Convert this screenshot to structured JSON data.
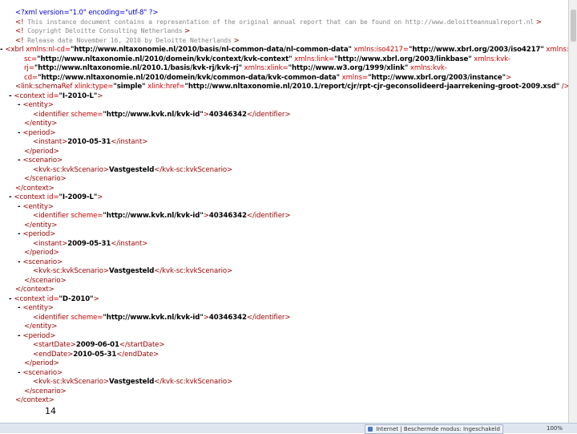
{
  "xml_lines": [
    {
      "indent": 1,
      "toggle": "",
      "parts": [
        [
          "pi",
          "<?xml version=\"1.0\" encoding=\"utf-8\" ?>"
        ]
      ]
    },
    {
      "indent": 1,
      "toggle": "",
      "parts": [
        [
          "tag",
          "<!"
        ],
        [
          "cm",
          "   This instance document contains a representation of the original annual report that can be found on http://www.deloitteannualreport.nl"
        ],
        [
          "tag",
          "          >"
        ]
      ]
    },
    {
      "indent": 1,
      "toggle": "",
      "parts": [
        [
          "tag",
          "<!"
        ],
        [
          "cm",
          "   Copyright Deloitte Consulting Netherlands"
        ],
        [
          "tag",
          "       >"
        ]
      ]
    },
    {
      "indent": 1,
      "toggle": "",
      "parts": [
        [
          "tag",
          "<!"
        ],
        [
          "cm",
          "   Release date November 16, 2010 by Deloitte Netherlands"
        ],
        [
          "tag",
          "       >"
        ]
      ]
    },
    {
      "indent": 0,
      "toggle": "-",
      "parts": [
        [
          "tag",
          "<xbrl "
        ],
        [
          "attr",
          "xmlns:nl-cd="
        ],
        [
          "val",
          "\"http://www.nltaxonomie.nl/2010/basis/nl-common-data/nl-common-data\""
        ],
        [
          "attr",
          " xmlns:iso4217="
        ],
        [
          "val",
          "\"http://www.xbrl.org/2003/iso4217\""
        ],
        [
          "attr",
          " xmlns:kvk-"
        ]
      ]
    },
    {
      "indent": 2,
      "toggle": "",
      "parts": [
        [
          "attr",
          "sc="
        ],
        [
          "val",
          "\"http://www.nltaxonomie.nl/2010/domein/kvk/context/kvk-context\""
        ],
        [
          "attr",
          " xmlns:link="
        ],
        [
          "val",
          "\"http://www.xbrl.org/2003/linkbase\""
        ],
        [
          "attr",
          " xmlns:kvk-"
        ]
      ]
    },
    {
      "indent": 2,
      "toggle": "",
      "parts": [
        [
          "attr",
          "rj="
        ],
        [
          "val",
          "\"http://www.nltaxonomie.nl/2010.1/basis/kvk-rj/kvk-rj\""
        ],
        [
          "attr",
          " xmlns:xlink="
        ],
        [
          "val",
          "\"http://www.w3.org/1999/xlink\""
        ],
        [
          "attr",
          " xmlns:kvk-"
        ]
      ]
    },
    {
      "indent": 2,
      "toggle": "",
      "parts": [
        [
          "attr",
          "cd="
        ],
        [
          "val",
          "\"http://www.nltaxonomie.nl/2010/domein/kvk/common-data/kvk-common-data\""
        ],
        [
          "attr",
          " xmlns="
        ],
        [
          "val",
          "\"http://www.xbrl.org/2003/instance\""
        ],
        [
          "tag",
          ">"
        ]
      ]
    },
    {
      "indent": 1,
      "toggle": "",
      "parts": [
        [
          "tag",
          "<link:schemaRef "
        ],
        [
          "attr",
          "xlink:type="
        ],
        [
          "val",
          "\"simple\""
        ],
        [
          "attr",
          " xlink:href="
        ],
        [
          "val",
          "\"http://www.nltaxonomie.nl/2010.1/report/cjr/rpt-cjr-geconsolideerd-jaarrekening-groot-2009.xsd\""
        ],
        [
          "tag",
          " />"
        ]
      ]
    },
    {
      "indent": 1,
      "toggle": "-",
      "parts": [
        [
          "tag",
          "<context "
        ],
        [
          "attr",
          "id="
        ],
        [
          "val",
          "\"I-2010-L\""
        ],
        [
          "tag",
          ">"
        ]
      ]
    },
    {
      "indent": 2,
      "toggle": "-",
      "parts": [
        [
          "tag",
          "<entity>"
        ]
      ]
    },
    {
      "indent": 3,
      "toggle": "",
      "parts": [
        [
          "tag",
          "<identifier "
        ],
        [
          "attr",
          "scheme="
        ],
        [
          "val",
          "\"http://www.kvk.nl/kvk-id\""
        ],
        [
          "tag",
          ">"
        ],
        [
          "txt",
          "40346342"
        ],
        [
          "tag",
          "</identifier>"
        ]
      ]
    },
    {
      "indent": 2,
      "toggle": "",
      "parts": [
        [
          "tag",
          "</entity>"
        ]
      ]
    },
    {
      "indent": 2,
      "toggle": "-",
      "parts": [
        [
          "tag",
          "<period>"
        ]
      ]
    },
    {
      "indent": 3,
      "toggle": "",
      "parts": [
        [
          "tag",
          "<instant>"
        ],
        [
          "txt",
          "2010-05-31"
        ],
        [
          "tag",
          "</instant>"
        ]
      ]
    },
    {
      "indent": 2,
      "toggle": "",
      "parts": [
        [
          "tag",
          "</period>"
        ]
      ]
    },
    {
      "indent": 2,
      "toggle": "-",
      "parts": [
        [
          "tag",
          "<scenario>"
        ]
      ]
    },
    {
      "indent": 3,
      "toggle": "",
      "parts": [
        [
          "tag",
          "<kvk-sc:kvkScenario>"
        ],
        [
          "txt",
          "Vastgesteld"
        ],
        [
          "tag",
          "</kvk-sc:kvkScenario>"
        ]
      ]
    },
    {
      "indent": 2,
      "toggle": "",
      "parts": [
        [
          "tag",
          "</scenario>"
        ]
      ]
    },
    {
      "indent": 1,
      "toggle": "",
      "parts": [
        [
          "tag",
          "</context>"
        ]
      ]
    },
    {
      "indent": 1,
      "toggle": "-",
      "parts": [
        [
          "tag",
          "<context "
        ],
        [
          "attr",
          "id="
        ],
        [
          "val",
          "\"I-2009-L\""
        ],
        [
          "tag",
          ">"
        ]
      ]
    },
    {
      "indent": 2,
      "toggle": "-",
      "parts": [
        [
          "tag",
          "<entity>"
        ]
      ]
    },
    {
      "indent": 3,
      "toggle": "",
      "parts": [
        [
          "tag",
          "<identifier "
        ],
        [
          "attr",
          "scheme="
        ],
        [
          "val",
          "\"http://www.kvk.nl/kvk-id\""
        ],
        [
          "tag",
          ">"
        ],
        [
          "txt",
          "40346342"
        ],
        [
          "tag",
          "</identifier>"
        ]
      ]
    },
    {
      "indent": 2,
      "toggle": "",
      "parts": [
        [
          "tag",
          "</entity>"
        ]
      ]
    },
    {
      "indent": 2,
      "toggle": "-",
      "parts": [
        [
          "tag",
          "<period>"
        ]
      ]
    },
    {
      "indent": 3,
      "toggle": "",
      "parts": [
        [
          "tag",
          "<instant>"
        ],
        [
          "txt",
          "2009-05-31"
        ],
        [
          "tag",
          "</instant>"
        ]
      ]
    },
    {
      "indent": 2,
      "toggle": "",
      "parts": [
        [
          "tag",
          "</period>"
        ]
      ]
    },
    {
      "indent": 2,
      "toggle": "-",
      "parts": [
        [
          "tag",
          "<scenario>"
        ]
      ]
    },
    {
      "indent": 3,
      "toggle": "",
      "parts": [
        [
          "tag",
          "<kvk-sc:kvkScenario>"
        ],
        [
          "txt",
          "Vastgesteld"
        ],
        [
          "tag",
          "</kvk-sc:kvkScenario>"
        ]
      ]
    },
    {
      "indent": 2,
      "toggle": "",
      "parts": [
        [
          "tag",
          "</scenario>"
        ]
      ]
    },
    {
      "indent": 1,
      "toggle": "",
      "parts": [
        [
          "tag",
          "</context>"
        ]
      ]
    },
    {
      "indent": 1,
      "toggle": "-",
      "parts": [
        [
          "tag",
          "<context "
        ],
        [
          "attr",
          "id="
        ],
        [
          "val",
          "\"D-2010\""
        ],
        [
          "tag",
          ">"
        ]
      ]
    },
    {
      "indent": 2,
      "toggle": "-",
      "parts": [
        [
          "tag",
          "<entity>"
        ]
      ]
    },
    {
      "indent": 3,
      "toggle": "",
      "parts": [
        [
          "tag",
          "<identifier "
        ],
        [
          "attr",
          "scheme="
        ],
        [
          "val",
          "\"http://www.kvk.nl/kvk-id\""
        ],
        [
          "tag",
          ">"
        ],
        [
          "txt",
          "40346342"
        ],
        [
          "tag",
          "</identifier>"
        ]
      ]
    },
    {
      "indent": 2,
      "toggle": "",
      "parts": [
        [
          "tag",
          "</entity>"
        ]
      ]
    },
    {
      "indent": 2,
      "toggle": "-",
      "parts": [
        [
          "tag",
          "<period>"
        ]
      ]
    },
    {
      "indent": 3,
      "toggle": "",
      "parts": [
        [
          "tag",
          "<startDate>"
        ],
        [
          "txt",
          "2009-06-01"
        ],
        [
          "tag",
          "</startDate>"
        ]
      ]
    },
    {
      "indent": 3,
      "toggle": "",
      "parts": [
        [
          "tag",
          "<endDate>"
        ],
        [
          "txt",
          "2010-05-31"
        ],
        [
          "tag",
          "</endDate>"
        ]
      ]
    },
    {
      "indent": 2,
      "toggle": "",
      "parts": [
        [
          "tag",
          "</period>"
        ]
      ]
    },
    {
      "indent": 2,
      "toggle": "-",
      "parts": [
        [
          "tag",
          "<scenario>"
        ]
      ]
    },
    {
      "indent": 3,
      "toggle": "",
      "parts": [
        [
          "tag",
          "<kvk-sc:kvkScenario>"
        ],
        [
          "txt",
          "Vastgesteld"
        ],
        [
          "tag",
          "</kvk-sc:kvkScenario>"
        ]
      ]
    },
    {
      "indent": 2,
      "toggle": "",
      "parts": [
        [
          "tag",
          "</scenario>"
        ]
      ]
    },
    {
      "indent": 1,
      "toggle": "",
      "parts": [
        [
          "tag",
          "</context>"
        ]
      ]
    }
  ],
  "page_number": "14",
  "taskbar": {
    "item_label": "Internet | Beschermde modus: Ingeschakeld",
    "zoom": "100%"
  },
  "colors": {
    "tag": "#990000",
    "attribute": "#cc0000",
    "comment": "#888888",
    "processing_instruction": "#0000cc"
  }
}
